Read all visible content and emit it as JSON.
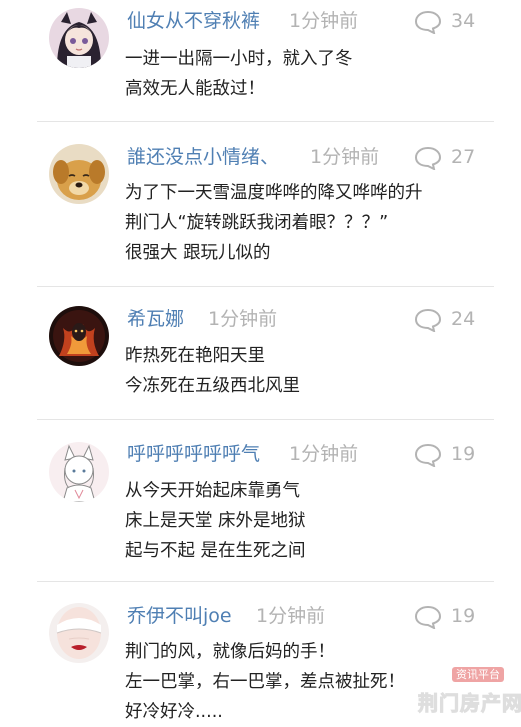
{
  "comments": [
    {
      "username": "仙女从不穿秋裤",
      "time": "1分钟前",
      "reply_count": "34",
      "avatar_icon": "anime-girl-avatar",
      "lines": [
        "一进一出隔一小时，就入了冬",
        "高效无人能敌过！"
      ]
    },
    {
      "username": "誰还没点小情绪、",
      "time": "1分钟前",
      "reply_count": "27",
      "avatar_icon": "puppy-avatar",
      "lines": [
        "为了下一天雪温度哗哗的降又哗哗的升",
        "荆门人“旋转跳跃我闭着眼？？？”",
        "很强大 跟玩儿似的"
      ]
    },
    {
      "username": "希瓦娜",
      "time": "1分钟前",
      "reply_count": "24",
      "avatar_icon": "fire-warrior-avatar",
      "lines": [
        "昨热死在艳阳天里",
        "今冻死在五级西北风里"
      ]
    },
    {
      "username": "呼呼呼呼呼呼气",
      "time": "1分钟前",
      "reply_count": "19",
      "avatar_icon": "fox-boy-avatar",
      "lines": [
        "从今天开始起床靠勇气",
        "床上是天堂 床外是地狱",
        "起与不起 是在生死之间"
      ]
    },
    {
      "username": "乔伊不叫joe",
      "time": "1分钟前",
      "reply_count": "19",
      "avatar_icon": "masked-girl-avatar",
      "lines": [
        "荆门的风，就像后妈的手！",
        "左一巴掌，右一巴掌，差点被扯死！",
        "好冷好冷....."
      ]
    }
  ],
  "watermark": {
    "small_text": "资讯平台",
    "big_text": "荆门房产网"
  },
  "colors": {
    "username": "#4f7fb3",
    "meta": "#b3b3b3",
    "body_text": "#222222",
    "divider": "#e5e5e5"
  }
}
